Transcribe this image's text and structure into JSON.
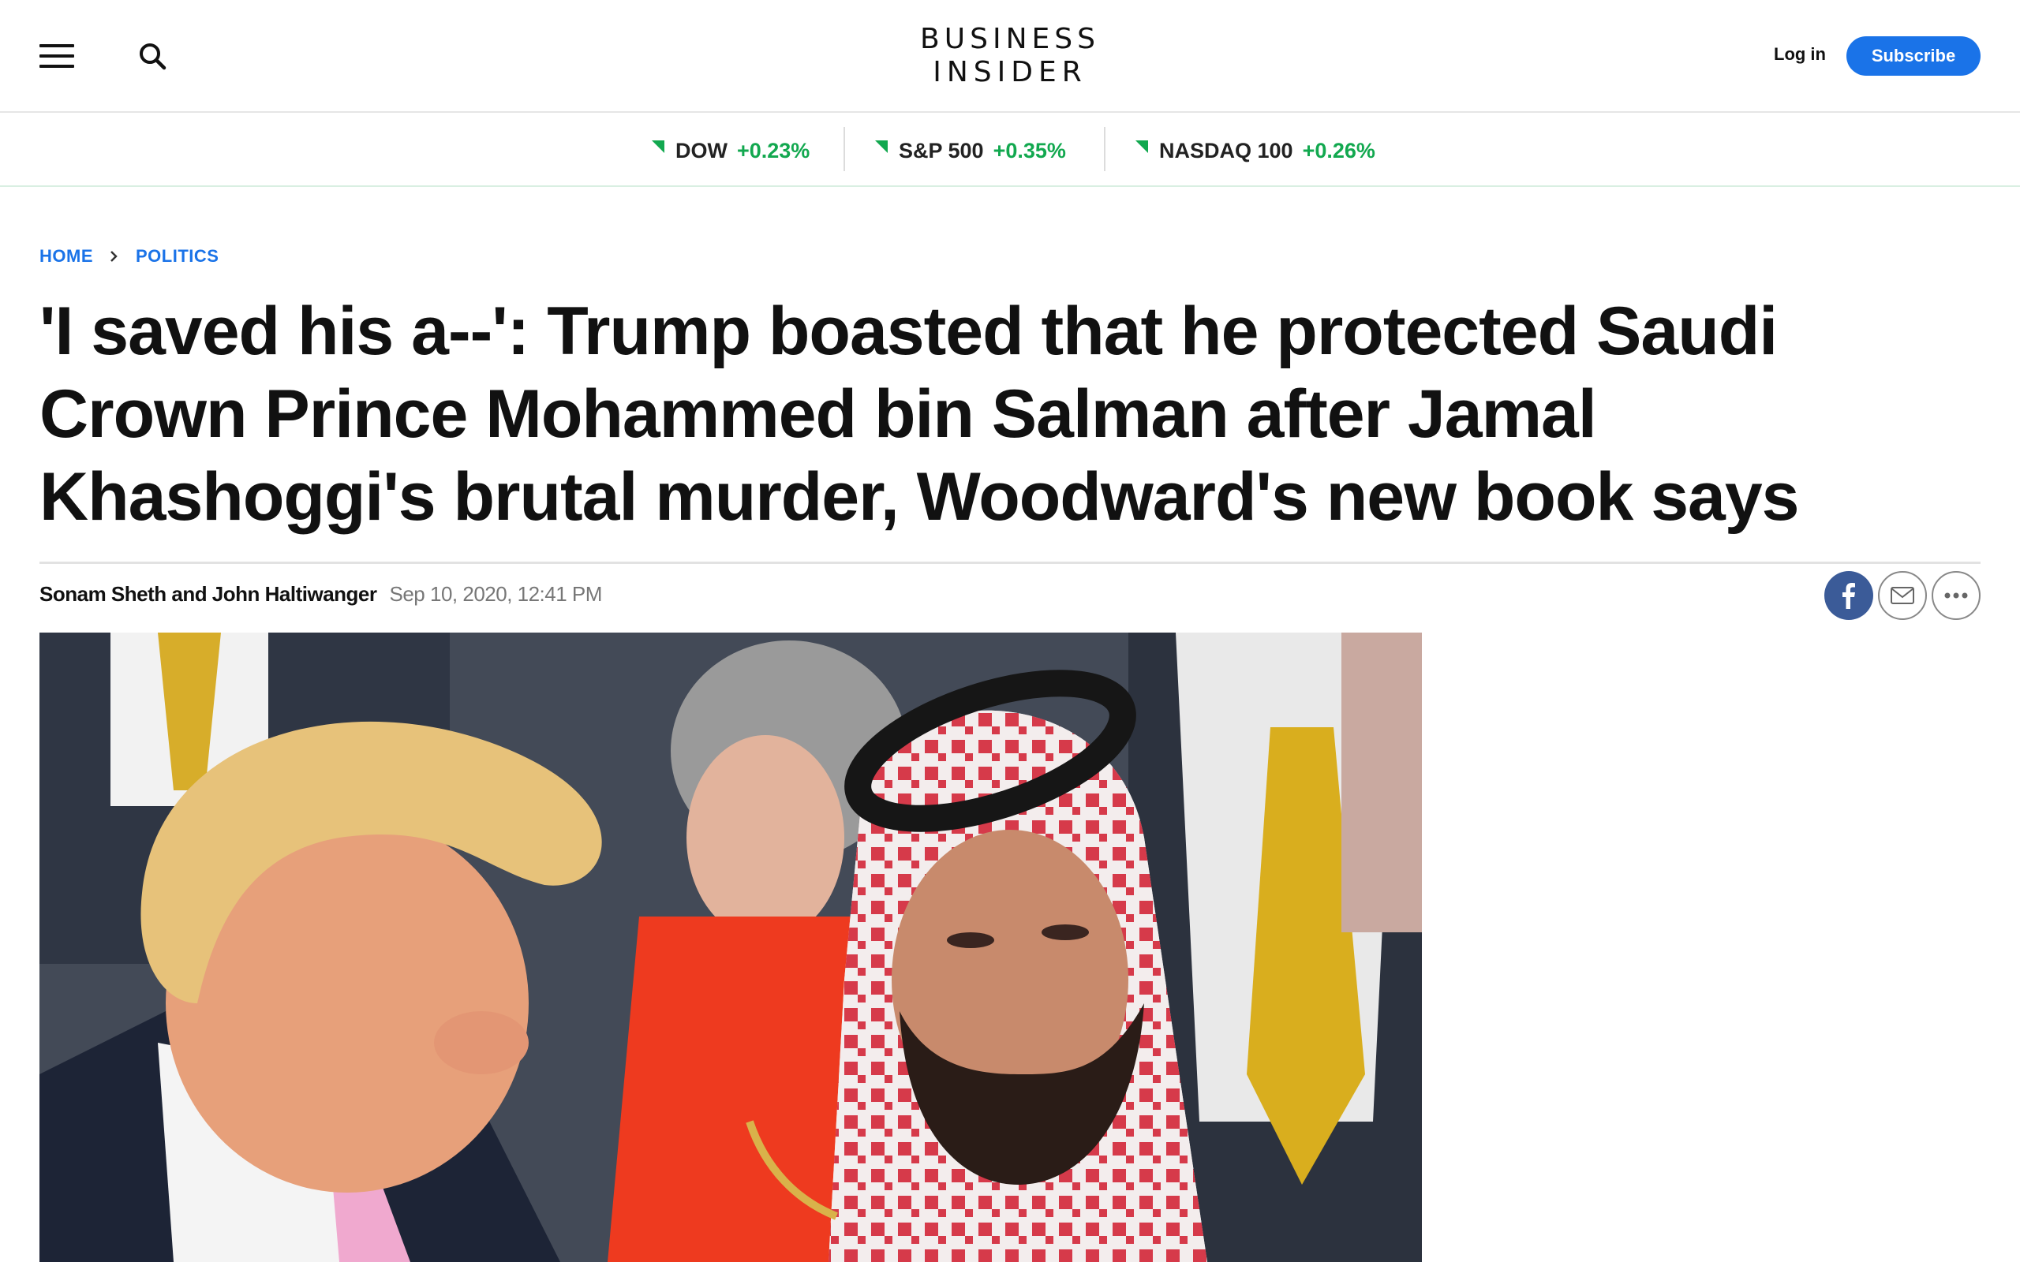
{
  "header": {
    "logo_line1": "BUSINESS",
    "logo_line2": "INSIDER",
    "login_label": "Log in",
    "subscribe_label": "Subscribe",
    "accent_color": "#1a73e8"
  },
  "markets": [
    {
      "name": "DOW",
      "change": "+0.23%"
    },
    {
      "name": "S&P 500",
      "change": "+0.35%"
    },
    {
      "name": "NASDAQ 100",
      "change": "+0.26%"
    }
  ],
  "breadcrumb": {
    "home": "HOME",
    "section": "POLITICS"
  },
  "article": {
    "headline": "'I saved his a--': Trump boasted that he protected Saudi Crown Prince Mohammed bin Salman after Jamal Khashoggi's brutal murder, Woodward's new book says",
    "authors": "Sonam Sheth and John Haltiwanger",
    "date": "Sep 10, 2020, 12:41 PM"
  },
  "icons": {
    "menu": "hamburger-menu-icon",
    "search": "search-icon",
    "facebook": "facebook-icon",
    "email": "email-icon",
    "more": "more-options-icon"
  },
  "colors": {
    "positive": "#12a84f",
    "facebook": "#3b5b98"
  }
}
